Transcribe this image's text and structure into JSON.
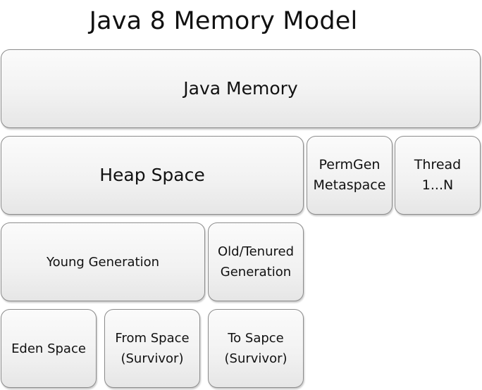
{
  "title": "Java 8 Memory Model",
  "boxes": {
    "java_memory": "Java Memory",
    "heap_space": "Heap Space",
    "permgen_metaspace": "PermGen\nMetaspace",
    "thread": "Thread\n1...N",
    "young_generation": "Young Generation",
    "old_tenured_generation": "Old/Tenured\nGeneration",
    "eden_space": "Eden Space",
    "from_space": "From Space\n(Survivor)",
    "to_space": "To Sapce\n(Survivor)"
  },
  "colors": {
    "box_border": "#8c8c8c",
    "box_fill_top": "#fbfbfb",
    "box_fill_bottom": "#e6e6e6",
    "text": "#111111"
  }
}
